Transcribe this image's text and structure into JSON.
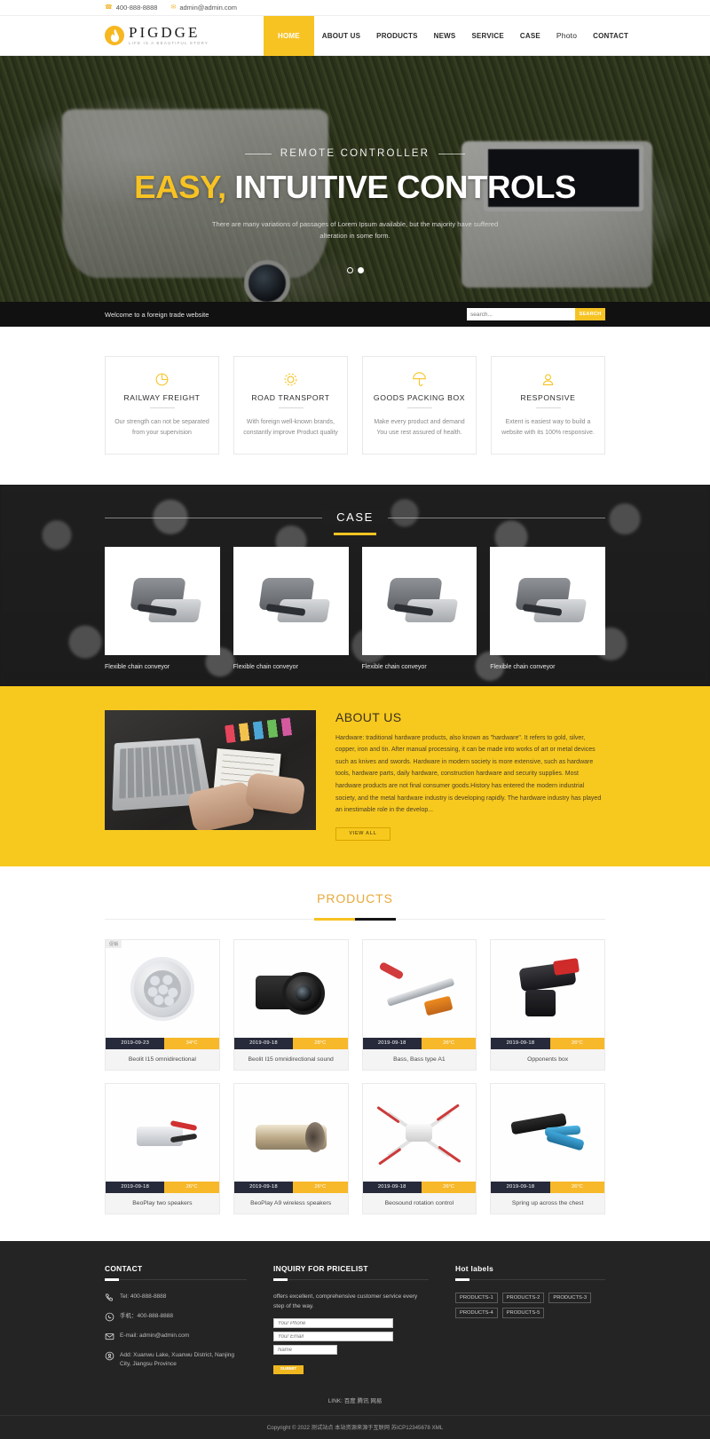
{
  "topbar": {
    "phone_icon": "phone-icon",
    "phone": "400-888-8888",
    "mail_icon": "mail-icon",
    "email": "admin@admin.com"
  },
  "header": {
    "logo_icon": "flame-logo-icon",
    "brand": "PIGDGE",
    "tagline": "LIFE IS A BEAUTIFUL STORY",
    "nav": [
      {
        "label": "HOME",
        "active": true
      },
      {
        "label": "ABOUT US",
        "active": false
      },
      {
        "label": "PRODUCTS",
        "active": false
      },
      {
        "label": "NEWS",
        "active": false
      },
      {
        "label": "SERVICE",
        "active": false
      },
      {
        "label": "CASE",
        "active": false
      },
      {
        "label": "Photo",
        "active": false
      },
      {
        "label": "CONTACT",
        "active": false
      }
    ]
  },
  "hero": {
    "kicker": "REMOTE CONTROLLER",
    "title_highlight": "EASY,",
    "title_rest": "INTUITIVE CONTROLS",
    "description": "There are many variations of passages of Lorem Ipsum available, but the majority have suffered alteration in some form.",
    "slides": 2,
    "active_slide": 2
  },
  "strip": {
    "welcome": "Welcome to a foreign trade website",
    "search_placeholder": "search...",
    "search_value": "",
    "search_button": "SEARCH"
  },
  "features": [
    {
      "icon": "pie-chart-icon",
      "title": "RAILWAY FREIGHT",
      "text": "Our strength can not be separated from your supervision"
    },
    {
      "icon": "gear-icon",
      "title": "ROAD TRANSPORT",
      "text": "With foreign well-known brands, constantly improve Product quality"
    },
    {
      "icon": "umbrella-icon",
      "title": "GOODS PACKING BOX",
      "text": "Make every product and demand You use rest assured of health."
    },
    {
      "icon": "user-icon",
      "title": "RESPONSIVE",
      "text": "Extent is easiest way to build a website with its 100% responsive."
    }
  ],
  "case": {
    "title": "CASE",
    "items": [
      {
        "caption": "Flexible chain conveyor"
      },
      {
        "caption": "Flexible chain conveyor"
      },
      {
        "caption": "Flexible chain conveyor"
      },
      {
        "caption": "Flexible chain conveyor"
      }
    ]
  },
  "about": {
    "title": "ABOUT US",
    "text": "Hardware: traditional hardware products, also known as \"hardware\". It refers to gold, silver, copper, iron and tin. After manual processing, it can be made into works of art or metal devices such as knives and swords. Hardware in modern society is more extensive, such as hardware tools, hardware parts, daily hardware, construction hardware and security supplies. Most hardware products are not final consumer goods.History has entered the modern industrial society, and the metal hardware industry is developing rapidly. The hardware industry has played an inestimable role in the develop...",
    "button": "VIEW ALL",
    "image_name": "desk-workspace-photo"
  },
  "products": {
    "title": "PRODUCTS",
    "items": [
      {
        "badge": "促销",
        "date": "2019-09-23",
        "temp": "34°C",
        "title": "Beolit I15 omnidirectional",
        "art": "led-floodlight"
      },
      {
        "badge": "",
        "date": "2019-09-18",
        "temp": "28°C",
        "title": "Beolit I15 omnidirectional sound",
        "art": "dslr-camera"
      },
      {
        "badge": "",
        "date": "2019-09-18",
        "temp": "26°C",
        "title": "Bass, Bass type A1",
        "art": "hand-tool"
      },
      {
        "badge": "",
        "date": "2019-09-18",
        "temp": "26°C",
        "title": "Opponents box",
        "art": "cordless-drill"
      },
      {
        "badge": "",
        "date": "2019-09-18",
        "temp": "26°C",
        "title": "BeoPlay two speakers",
        "art": "wire-connector"
      },
      {
        "badge": "",
        "date": "2019-09-18",
        "temp": "26°C",
        "title": "BeoPlay A9 wireless speakers",
        "art": "brass-pipe"
      },
      {
        "badge": "",
        "date": "2019-09-18",
        "temp": "26°C",
        "title": "Beosound rotation control",
        "art": "quadcopter"
      },
      {
        "badge": "",
        "date": "2019-09-18",
        "temp": "26°C",
        "title": "Spring up across the chest",
        "art": "crimping-tool"
      }
    ]
  },
  "footer": {
    "contact": {
      "heading": "CONTACT",
      "lines": [
        {
          "icon": "phone-icon",
          "text": "Tel:  400-888-8888"
        },
        {
          "icon": "whatsapp-icon",
          "text": "手机：400-888-8888"
        },
        {
          "icon": "mail-icon",
          "text": "E-mail: admin@admin.com"
        },
        {
          "icon": "location-pin-icon",
          "text": "Add:  Xuanwu Lake, Xuanwu District, Nanjing City, Jiangsu Province"
        }
      ]
    },
    "inquiry": {
      "heading": "INQUIRY FOR PRICELIST",
      "text": "offers excellent, comprehensive customer service every step of the way.",
      "phone_placeholder": "Your Phone",
      "email_placeholder": "Your Email",
      "name_placeholder": "Name",
      "submit": "SUBMIT"
    },
    "hot": {
      "heading": "Hot labels",
      "tags": [
        "PRODUCTS-1",
        "PRODUCTS-2",
        "PRODUCTS-3",
        "PRODUCTS-4",
        "PRODUCTS-5"
      ]
    },
    "link_line": "LINK: 百度 腾讯 网易",
    "copyright": "Copyright © 2022 测试站点 本站资源来源于互联网  苏ICP12345678    XML"
  },
  "colors": {
    "brand_yellow": "#f7c323",
    "accent_yellow": "#f7c91e",
    "dark": "#242424",
    "badge_navy": "#272a3b"
  }
}
